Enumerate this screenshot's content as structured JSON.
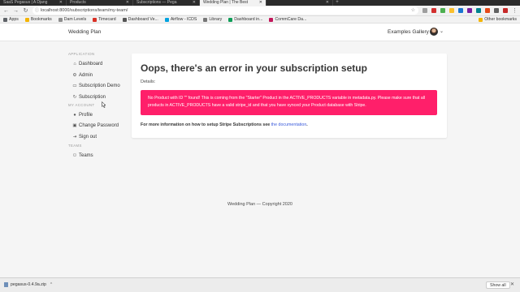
{
  "browser": {
    "tabs": [
      {
        "title": "SaaS Pegasus | A Djang",
        "active": false
      },
      {
        "title": "Products",
        "active": false
      },
      {
        "title": "Subscriptions — Pega",
        "active": false
      },
      {
        "title": "Wedding Plan | The Best",
        "active": true
      },
      {
        "title": "",
        "active": false
      }
    ],
    "url": "localhost:8000/subscriptions/team/my-team/",
    "bookmarks": [
      {
        "label": "Apps",
        "color": "#5f6368"
      },
      {
        "label": "Bookmarks",
        "color": "#f4b400"
      },
      {
        "label": "Dam Levels",
        "color": "#8e8e8e"
      },
      {
        "label": "Timecard",
        "color": "#d93025"
      },
      {
        "label": "Dashboard Ve...",
        "color": "#555555"
      },
      {
        "label": "Airflow - ICDS",
        "color": "#00a3e0"
      },
      {
        "label": "Library",
        "color": "#777777"
      },
      {
        "label": "Dashboard in...",
        "color": "#0f9d58"
      },
      {
        "label": "CommCare Da...",
        "color": "#c2185b"
      }
    ],
    "other_bookmarks": "Other bookmarks"
  },
  "header": {
    "brand": "Wedding Plan",
    "examples_link": "Examples Gallery"
  },
  "sidebar": {
    "sections": [
      {
        "heading": "APPLICATION",
        "items": [
          {
            "label": "Dashboard",
            "icon": "home-icon"
          },
          {
            "label": "Admin",
            "icon": "settings-icon"
          },
          {
            "label": "Subscription Demo",
            "icon": "monitor-icon"
          },
          {
            "label": "Subscription",
            "icon": "refresh-icon"
          }
        ]
      },
      {
        "heading": "MY ACCOUNT",
        "items": [
          {
            "label": "Profile",
            "icon": "user-icon"
          },
          {
            "label": "Change Password",
            "icon": "lock-icon"
          },
          {
            "label": "Sign out",
            "icon": "signout-icon"
          }
        ]
      },
      {
        "heading": "TEAMS",
        "items": [
          {
            "label": "Teams",
            "icon": "users-icon"
          }
        ]
      }
    ]
  },
  "main": {
    "title": "Oops, there's an error in your subscription setup",
    "details_label": "Details:",
    "error_message": "No Product with ID \"\" found! This is coming from the \"Starter\" Product in the ACTIVE_PRODUCTS variable in metadata.py. Please make sure that all products in ACTIVE_PRODUCTS have a valid stripe_id and that you have synced your Product database with Stripe.",
    "more_info_prefix": "For more information on how to setup Stripe Subscriptions see",
    "doc_link": "the documentation",
    "more_info_suffix": ".",
    "error_color": "#ff1f6a"
  },
  "footer": {
    "text": "Wedding Plan — Copyright 2020"
  },
  "downloads": {
    "file": "pegasus-0.4.9a.zip",
    "show_all": "Show all"
  }
}
